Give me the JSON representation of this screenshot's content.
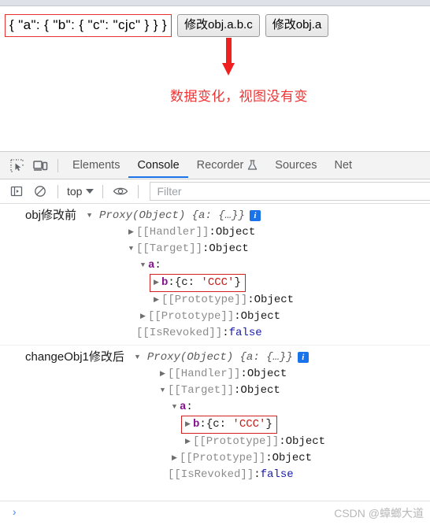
{
  "page": {
    "json_display": "{ \"a\": { \"b\": { \"c\": \"cjc\" } } }",
    "buttons": [
      {
        "label": "修改obj.a.b.c"
      },
      {
        "label": "修改obj.a"
      }
    ],
    "annotation": {
      "text": "数据变化，视图没有变",
      "color": "#ef3333",
      "arrow": "down-arrow"
    },
    "highlight_color": "#e83030"
  },
  "devtools": {
    "toolbar_icons": [
      {
        "name": "inspect-element-icon"
      },
      {
        "name": "device-toolbar-icon"
      }
    ],
    "tabs": [
      {
        "label": "Elements",
        "active": false
      },
      {
        "label": "Console",
        "active": true
      },
      {
        "label": "Recorder",
        "active": false,
        "icon": "flask-icon"
      },
      {
        "label": "Sources",
        "active": false
      },
      {
        "label": "Net",
        "active": false
      }
    ],
    "console_toolbar": {
      "sidebar_icon": "console-sidebar-icon",
      "clear_icon": "clear-console-icon",
      "context_value": "top",
      "eye_icon": "live-expression-eye-icon",
      "filter_placeholder": "Filter"
    },
    "accent_color": "#1a73e8"
  },
  "console": {
    "entries": [
      {
        "label": "obj修改前",
        "value_preview": "Proxy(Object) {a: {…}}",
        "info_badge": "i",
        "rows": [
          {
            "indent": 1,
            "twisty": "right",
            "key": "[[Handler]]",
            "key_style": "internal",
            "sep": ": ",
            "value": "Object",
            "value_style": "obj",
            "highlighted": false
          },
          {
            "indent": 1,
            "twisty": "down",
            "key": "[[Target]]",
            "key_style": "internal",
            "sep": ": ",
            "value": "Object",
            "value_style": "obj",
            "highlighted": false
          },
          {
            "indent": 2,
            "twisty": "down",
            "key": "a",
            "key_style": "prop",
            "sep": ":",
            "value": "",
            "value_style": "obj",
            "highlighted": false
          },
          {
            "indent": 3,
            "twisty": "right",
            "key": "b",
            "key_style": "prop",
            "sep": ": ",
            "value": "{c: 'CCC'}",
            "value_style": "objlit",
            "highlighted": true
          },
          {
            "indent": 3,
            "twisty": "right",
            "key": "[[Prototype]]",
            "key_style": "internal",
            "sep": ": ",
            "value": "Object",
            "value_style": "obj",
            "highlighted": false
          },
          {
            "indent": 2,
            "twisty": "right",
            "key": "[[Prototype]]",
            "key_style": "internal",
            "sep": ": ",
            "value": "Object",
            "value_style": "obj",
            "highlighted": false
          },
          {
            "indent": 1,
            "twisty": "none",
            "key": "[[IsRevoked]]",
            "key_style": "internal",
            "sep": ": ",
            "value": "false",
            "value_style": "bool",
            "highlighted": false
          }
        ]
      },
      {
        "label": "changeObj1修改后",
        "value_preview": "Proxy(Object) {a: {…}}",
        "info_badge": "i",
        "rows": [
          {
            "indent": 1,
            "twisty": "right",
            "key": "[[Handler]]",
            "key_style": "internal",
            "sep": ": ",
            "value": "Object",
            "value_style": "obj",
            "highlighted": false
          },
          {
            "indent": 1,
            "twisty": "down",
            "key": "[[Target]]",
            "key_style": "internal",
            "sep": ": ",
            "value": "Object",
            "value_style": "obj",
            "highlighted": false
          },
          {
            "indent": 2,
            "twisty": "down",
            "key": "a",
            "key_style": "prop",
            "sep": ":",
            "value": "",
            "value_style": "obj",
            "highlighted": false
          },
          {
            "indent": 3,
            "twisty": "right",
            "key": "b",
            "key_style": "prop",
            "sep": ": ",
            "value": "{c: 'CCC'}",
            "value_style": "objlit",
            "highlighted": true
          },
          {
            "indent": 3,
            "twisty": "right",
            "key": "[[Prototype]]",
            "key_style": "internal",
            "sep": ": ",
            "value": "Object",
            "value_style": "obj",
            "highlighted": false
          },
          {
            "indent": 2,
            "twisty": "right",
            "key": "[[Prototype]]",
            "key_style": "internal",
            "sep": ": ",
            "value": "Object",
            "value_style": "obj",
            "highlighted": false
          },
          {
            "indent": 1,
            "twisty": "none",
            "key": "[[IsRevoked]]",
            "key_style": "internal",
            "sep": ": ",
            "value": "false",
            "value_style": "bool",
            "highlighted": false
          }
        ]
      }
    ],
    "prompt_caret": "›"
  },
  "watermark": "CSDN @蟑螂大道"
}
